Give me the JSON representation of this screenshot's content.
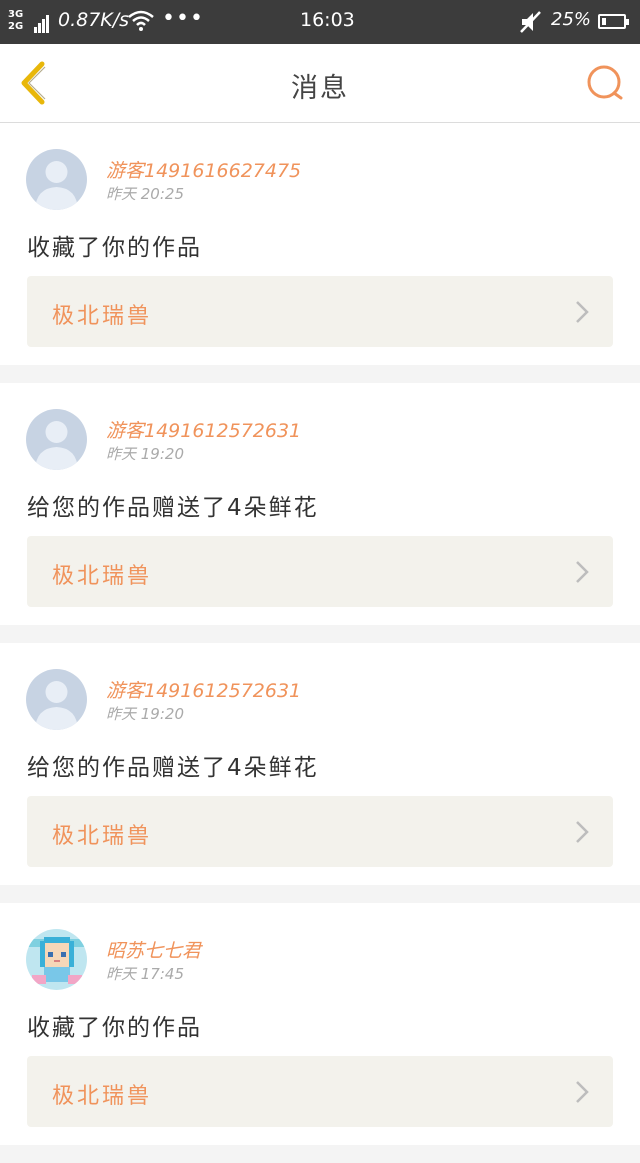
{
  "status_bar": {
    "network_types": "3G\n2G",
    "speed": "0.87K/s",
    "dots": "•••",
    "time": "16:03",
    "battery_text": "25%",
    "icons": [
      "signal-icon",
      "wifi-icon",
      "mute-icon",
      "battery-icon"
    ]
  },
  "header": {
    "title": "消息",
    "back_icon": "chevron-left-icon",
    "search_icon": "search-icon",
    "accent_color": "#f0935b",
    "back_color": "#e8b70a"
  },
  "messages": [
    {
      "username": "游客1491616627475",
      "time": "昨天 20:25",
      "action": "收藏了你的作品",
      "work_title": "极北瑞兽",
      "avatar": "default-avatar"
    },
    {
      "username": "游客1491612572631",
      "time": "昨天 19:20",
      "action": "给您的作品赠送了4朵鲜花",
      "work_title": "极北瑞兽",
      "avatar": "default-avatar"
    },
    {
      "username": "游客1491612572631",
      "time": "昨天 19:20",
      "action": "给您的作品赠送了4朵鲜花",
      "work_title": "极北瑞兽",
      "avatar": "default-avatar"
    },
    {
      "username": "昭苏七七君",
      "time": "昨天 17:45",
      "action": "收藏了你的作品",
      "work_title": "极北瑞兽",
      "avatar": "pixel-character-avatar"
    }
  ]
}
